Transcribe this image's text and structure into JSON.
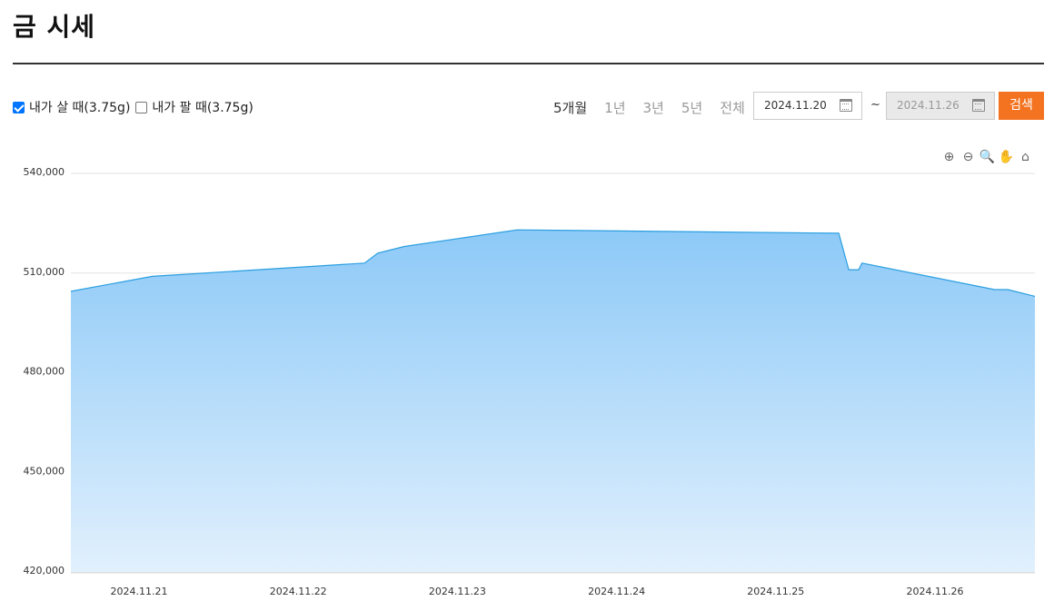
{
  "page": {
    "title": "금 시세"
  },
  "filters": {
    "buy_label": "내가 살 때(3.75g)",
    "buy_checked": true,
    "sell_label": "내가 팔 때(3.75g)",
    "sell_checked": false,
    "periods": [
      {
        "label": "5개월",
        "active": true
      },
      {
        "label": "1년",
        "active": false
      },
      {
        "label": "3년",
        "active": false
      },
      {
        "label": "5년",
        "active": false
      },
      {
        "label": "전체",
        "active": false
      }
    ],
    "start_date": "2024.11.20",
    "end_date": "2024.11.26",
    "range_separator": "~",
    "search_label": "검색"
  },
  "toolbar": {
    "icons": [
      "zoom-in-icon",
      "zoom-out-icon",
      "zoom-select-icon",
      "pan-hand-icon",
      "home-reset-icon"
    ],
    "glyphs": [
      "⊕",
      "⊖",
      "🔍",
      "✋",
      "⌂"
    ]
  },
  "colors": {
    "accent": "#f37321",
    "series_line": "#2a9ee0",
    "area_top": "#8dc9f7",
    "area_bottom": "#e1f0fd",
    "checkbox": "#0075ff"
  },
  "chart_data": {
    "type": "area",
    "title": "",
    "xlabel": "",
    "ylabel": "",
    "ylim": [
      420000,
      540000
    ],
    "yticks": [
      420000,
      450000,
      480000,
      510000,
      540000
    ],
    "ytick_labels": [
      "420,000",
      "450,000",
      "480,000",
      "510,000",
      "540,000"
    ],
    "xticks": [
      "2024.11.21",
      "2024.11.22",
      "2024.11.23",
      "2024.11.24",
      "2024.11.25",
      "2024.11.26"
    ],
    "grid": true,
    "series": [
      {
        "points": [
          {
            "x": "2024.11.20 14:00",
            "y": 504500
          },
          {
            "x": "2024.11.21 02:00",
            "y": 509000
          },
          {
            "x": "2024.11.22 10:00",
            "y": 513000
          },
          {
            "x": "2024.11.22 12:00",
            "y": 516000
          },
          {
            "x": "2024.11.22 16:00",
            "y": 518000
          },
          {
            "x": "2024.11.23 09:00",
            "y": 523000
          },
          {
            "x": "2024.11.25 09:30",
            "y": 522000
          },
          {
            "x": "2024.11.25 11:00",
            "y": 511000
          },
          {
            "x": "2024.11.25 12:30",
            "y": 511000
          },
          {
            "x": "2024.11.25 13:00",
            "y": 513000
          },
          {
            "x": "2024.11.26 09:00",
            "y": 505000
          },
          {
            "x": "2024.11.26 11:00",
            "y": 505000
          },
          {
            "x": "2024.11.26 13:00",
            "y": 503000
          }
        ]
      }
    ]
  }
}
